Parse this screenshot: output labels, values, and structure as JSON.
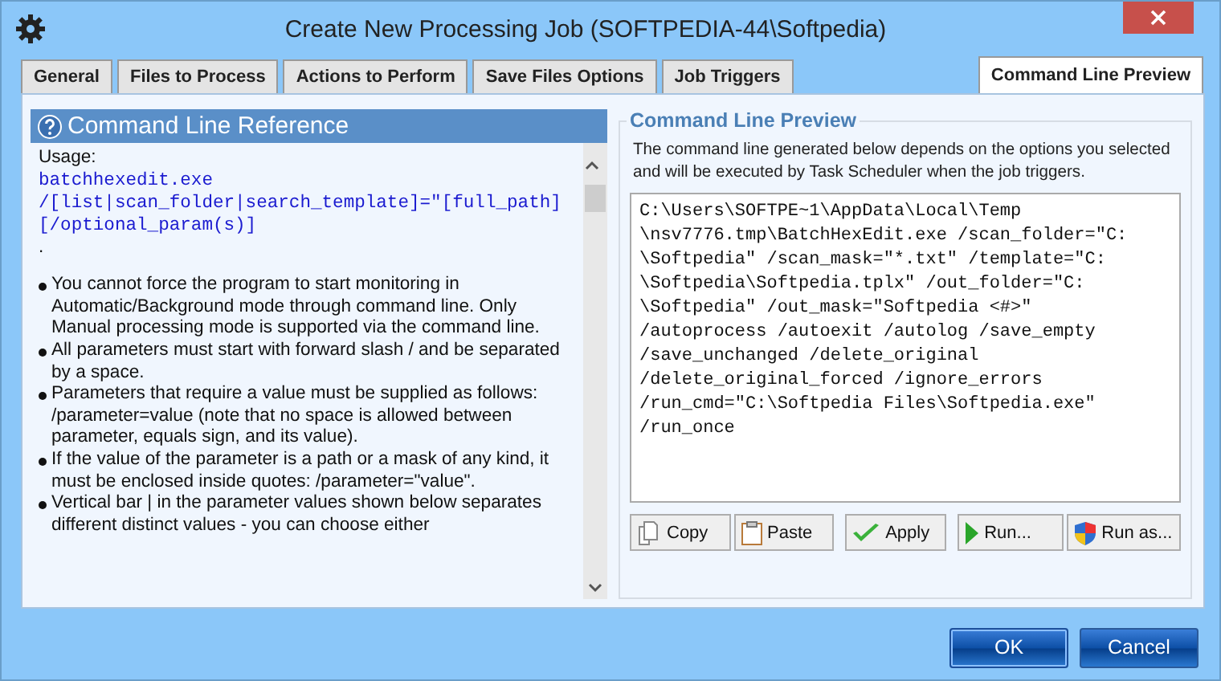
{
  "window": {
    "title": "Create New Processing Job (SOFTPEDIA-44\\Softpedia)"
  },
  "tabs": [
    {
      "label": "General",
      "selected": false
    },
    {
      "label": "Files to Process",
      "selected": false
    },
    {
      "label": "Actions to Perform",
      "selected": false
    },
    {
      "label": "Save Files Options",
      "selected": false
    },
    {
      "label": "Job Triggers",
      "selected": false
    },
    {
      "label": "Command Line Preview",
      "selected": true
    }
  ],
  "reference": {
    "title": "Command Line Reference",
    "content": [
      {
        "kind": "text",
        "text": "Usage:"
      },
      {
        "kind": "code",
        "text": "batchhexedit.exe"
      },
      {
        "kind": "code",
        "text": "/[list|scan_folder|search_template]=\"[full_path]"
      },
      {
        "kind": "code",
        "text": "[/optional_param(s)]"
      },
      {
        "kind": "text",
        "text": "."
      },
      {
        "kind": "bullet",
        "text": "You cannot force the program to start monitoring in Automatic/Background mode through command line. Only Manual processing mode is supported via the command line."
      },
      {
        "kind": "bullet",
        "text": "All parameters must start with forward slash / and be separated by a space."
      },
      {
        "kind": "bullet",
        "text": "Parameters that require a value must be supplied as follows: /parameter=value (note that no space is allowed between parameter, equals sign, and its value)."
      },
      {
        "kind": "bullet",
        "text": "If the value of the parameter is a path or a mask of any kind, it must be enclosed inside quotes: /parameter=\"value\"."
      },
      {
        "kind": "bullet",
        "text": "Vertical bar | in the parameter values shown below separates different distinct values - you can choose either"
      }
    ]
  },
  "preview": {
    "title": "Command Line Preview",
    "description": "The command line generated below depends on the options you selected and will be executed by Task Scheduler when the job triggers.",
    "command_lines": [
      "C:\\Users\\SOFTPE~1\\AppData\\Local\\Temp",
      "\\nsv7776.tmp\\BatchHexEdit.exe /scan_folder=\"C:",
      "\\Softpedia\" /scan_mask=\"*.txt\" /template=\"C:",
      "\\Softpedia\\Softpedia.tplx\" /out_folder=\"C:",
      "\\Softpedia\" /out_mask=\"Softpedia <#>\"",
      "/autoprocess /autoexit /autolog /save_empty",
      "/save_unchanged /delete_original",
      "/delete_original_forced /ignore_errors",
      "/run_cmd=\"C:\\Softpedia Files\\Softpedia.exe\"",
      "/run_once"
    ],
    "buttons": [
      {
        "kind": "copy",
        "label": "Copy"
      },
      {
        "kind": "paste",
        "label": "Paste"
      },
      {
        "kind": "apply",
        "label": "Apply"
      },
      {
        "kind": "run",
        "label": "Run..."
      },
      {
        "kind": "runas",
        "label": "Run as..."
      }
    ]
  },
  "dialog_buttons": [
    {
      "label": "OK",
      "default": true
    },
    {
      "label": "Cancel",
      "default": false
    }
  ]
}
